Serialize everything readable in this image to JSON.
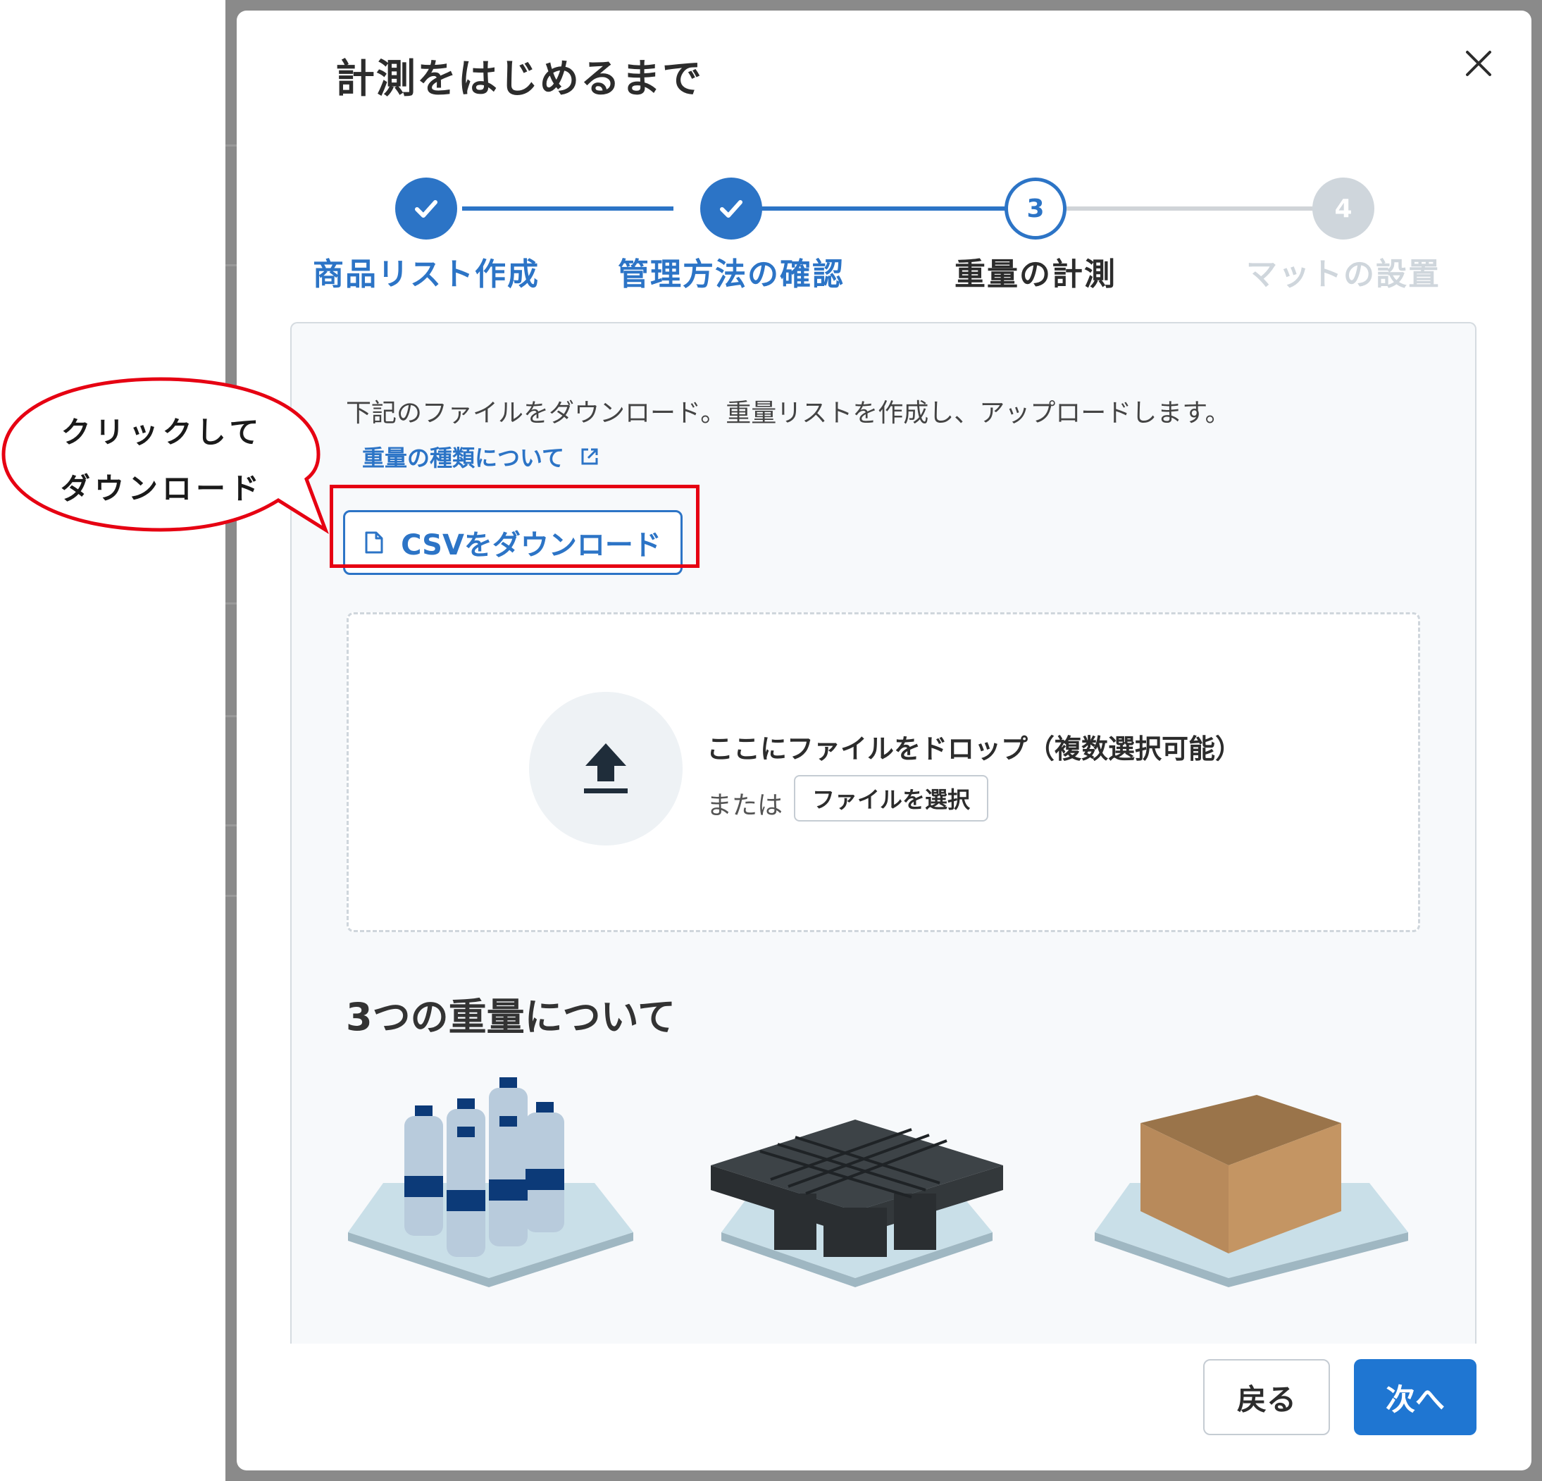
{
  "modal": {
    "title": "計測をはじめるまで",
    "close_icon": "close-icon"
  },
  "stepper": {
    "steps": [
      {
        "number": "1",
        "label": "商品リスト作成",
        "state": "done"
      },
      {
        "number": "2",
        "label": "管理方法の確認",
        "state": "done"
      },
      {
        "number": "3",
        "label": "重量の計測",
        "state": "current"
      },
      {
        "number": "4",
        "label": "マットの設置",
        "state": "pending"
      }
    ],
    "colors": {
      "done": "#2c74c6",
      "current_label": "#2c2c2c",
      "pending": "#cfd6dc"
    }
  },
  "panel": {
    "instruction": "下記のファイルをダウンロード。重量リストを作成し、アップロードします。",
    "link_label": "重量の種類について",
    "link_icon": "external-link-icon",
    "csv_button_label": "CSVをダウンロード",
    "csv_button_icon": "document-icon",
    "dropzone": {
      "icon": "upload-icon",
      "title": "ここにファイルをドロップ（複数選択可能）",
      "or_label": "または",
      "select_button_label": "ファイルを選択"
    },
    "section_heading": "3つの重量について"
  },
  "footer": {
    "back_label": "戻る",
    "next_label": "次へ",
    "primary_color": "#1f76d2"
  },
  "callout": {
    "line1": "クリックして",
    "line2": "ダウンロード",
    "highlight_color": "#e60012"
  }
}
